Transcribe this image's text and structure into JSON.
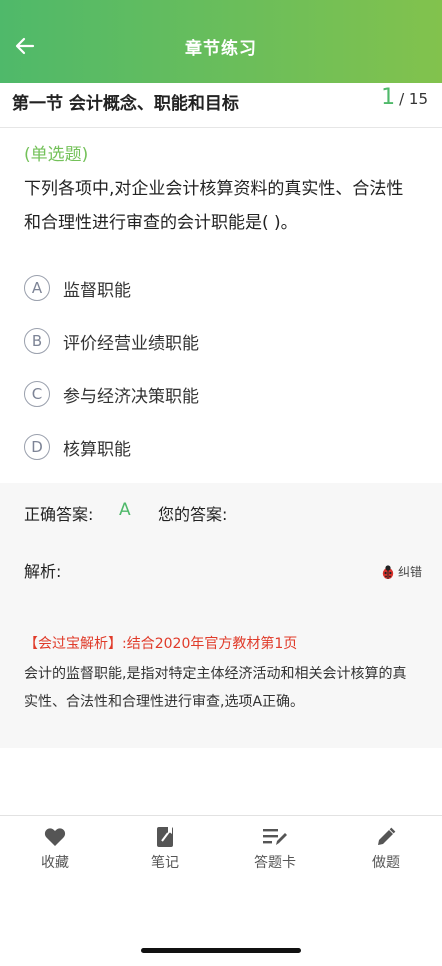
{
  "header": {
    "title": "章节练习",
    "back_icon": "arrow-left-icon"
  },
  "chapter": {
    "title": "第一节 会计概念、职能和目标",
    "current": "1",
    "total": "/ 15"
  },
  "question": {
    "type_label": "(单选题)",
    "text": "下列各项中,对企业会计核算资料的真实性、合法性和合理性进行审查的会计职能是(      )。",
    "options": [
      {
        "letter": "A",
        "text": "监督职能"
      },
      {
        "letter": "B",
        "text": "评价经营业绩职能"
      },
      {
        "letter": "C",
        "text": "参与经济决策职能"
      },
      {
        "letter": "D",
        "text": "核算职能"
      }
    ]
  },
  "answer": {
    "correct_label": "正确答案:",
    "correct_value": "A",
    "yours_label": "您的答案:",
    "analysis_label": "解析:",
    "report_label": "纠错",
    "analysis_source": "【会过宝解析】:结合2020年官方教材第1页",
    "analysis_text": "会计的监督职能,是指对特定主体经济活动和相关会计核算的真实性、合法性和合理性进行审查,选项A正确。"
  },
  "tabs": [
    {
      "label": "收藏",
      "icon": "heart-icon"
    },
    {
      "label": "笔记",
      "icon": "note-icon"
    },
    {
      "label": "答题卡",
      "icon": "answer-card-icon"
    },
    {
      "label": "做题",
      "icon": "pencil-icon"
    }
  ],
  "colors": {
    "header_start": "#4fb96a",
    "header_end": "#82c24d",
    "accent": "#4fb96a",
    "analysis_red": "#e03b2a"
  }
}
